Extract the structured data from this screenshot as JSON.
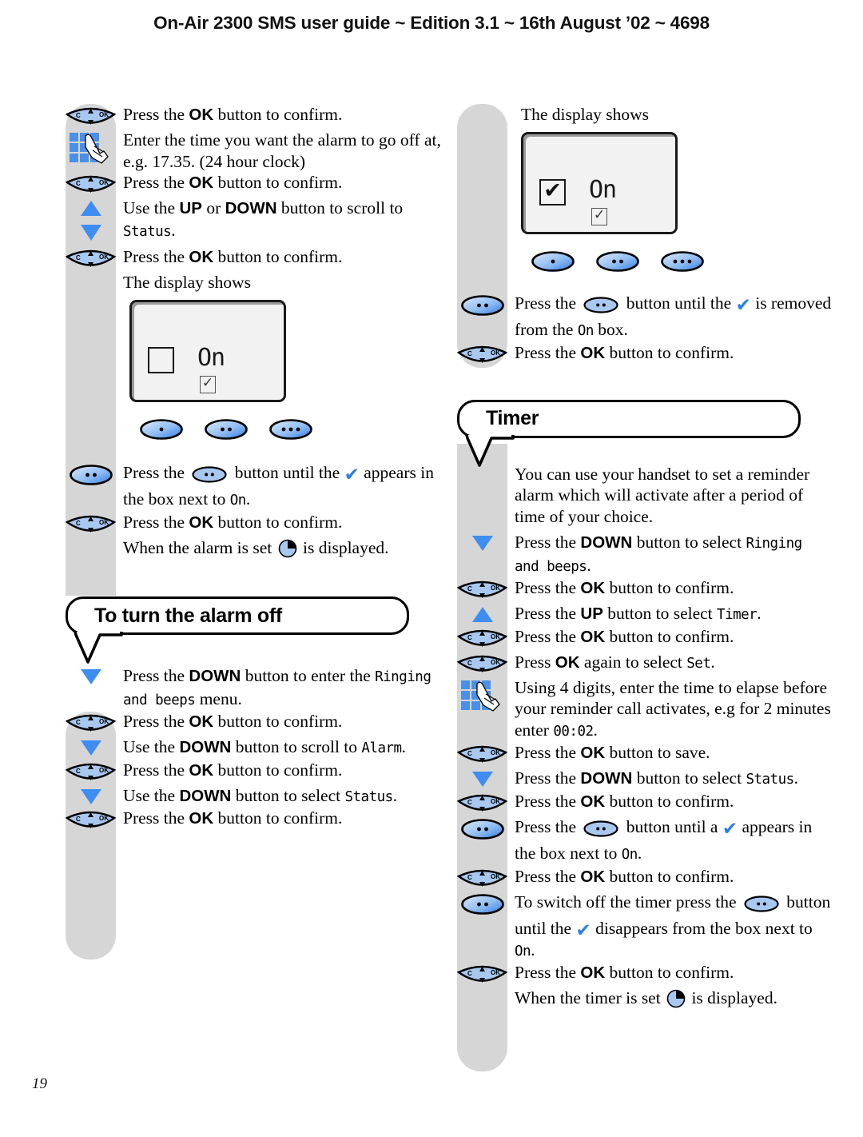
{
  "header": {
    "title": "On-Air 2300 SMS user guide ~ Edition 3.1 ~ 16th August ’02 ~ 4698"
  },
  "page_number": "19",
  "icons": {
    "navkey": {
      "left_label": "C",
      "right_label": "OK",
      "name": "ok-navigation-key-icon"
    },
    "keypad": {
      "name": "keypad-hand-icon"
    },
    "up": {
      "name": "up-arrow-icon"
    },
    "down": {
      "name": "down-arrow-icon"
    },
    "softkey_1dot": {
      "name": "softkey-one-dot-icon"
    },
    "softkey_2dot": {
      "name": "softkey-two-dot-icon"
    },
    "softkey_3dot": {
      "name": "softkey-three-dot-icon"
    },
    "check": {
      "name": "blue-check-icon",
      "glyph": "✔"
    },
    "clock": {
      "name": "clock-icon"
    }
  },
  "colors": {
    "rail_grey": "#d6d6d6",
    "key_blue": "#a8c8f0",
    "keypad_blue": "#4a90e8",
    "check_blue": "#2b7fe8",
    "lcd_bg": "#f2f2f2",
    "outline": "#000000"
  },
  "left_column": {
    "steps_top": [
      {
        "icon": "navkey",
        "parts": [
          {
            "t": "Press the "
          },
          {
            "t": "OK",
            "b": true
          },
          {
            "t": " button to confirm."
          }
        ]
      },
      {
        "icon": "keypad",
        "parts": [
          {
            "t": "Enter the time you want the alarm to go off at, e.g. 17.35. (24 hour clock)"
          }
        ]
      },
      {
        "icon": "navkey",
        "parts": [
          {
            "t": "Press the "
          },
          {
            "t": "OK",
            "b": true
          },
          {
            "t": " button to confirm."
          }
        ]
      },
      {
        "icon": "updown",
        "parts": [
          {
            "t": "Use the "
          },
          {
            "t": "UP",
            "b": true
          },
          {
            "t": " or "
          },
          {
            "t": "DOWN",
            "b": true
          },
          {
            "t": " button to scroll to "
          },
          {
            "t": "Status",
            "lcd": true
          },
          {
            "t": "."
          }
        ]
      },
      {
        "icon": "navkey",
        "parts": [
          {
            "t": "Press the "
          },
          {
            "t": "OK",
            "b": true
          },
          {
            "t": " button to confirm."
          }
        ]
      },
      {
        "icon": "none",
        "parts": [
          {
            "t": "The display shows"
          }
        ]
      }
    ],
    "display_label": "The display shows",
    "lcd": {
      "main_box_mark": "",
      "on_text": "On",
      "small_box_mark": "✓"
    },
    "steps_bottom": [
      {
        "icon": "softkey2",
        "parts": [
          {
            "t": "Press the "
          },
          {
            "oval": 2
          },
          {
            "t": " button until the "
          },
          {
            "check": true
          },
          {
            "t": " appears in the box next to "
          },
          {
            "t": "On",
            "lcd": true
          },
          {
            "t": "."
          }
        ]
      },
      {
        "icon": "navkey",
        "parts": [
          {
            "t": "Press the "
          },
          {
            "t": "OK",
            "b": true
          },
          {
            "t": " button to confirm."
          }
        ]
      },
      {
        "icon": "none",
        "parts": [
          {
            "t": "When the alarm is set "
          },
          {
            "clock": true
          },
          {
            "t": " is displayed."
          }
        ]
      }
    ],
    "heading": "To turn the alarm off",
    "steps_alarm_off": [
      {
        "icon": "down",
        "parts": [
          {
            "t": "Press the "
          },
          {
            "t": "DOWN",
            "b": true
          },
          {
            "t": " button to enter the "
          },
          {
            "t": "Ringing and beeps",
            "lcd": true
          },
          {
            "t": " menu."
          }
        ]
      },
      {
        "icon": "navkey",
        "parts": [
          {
            "t": "Press the "
          },
          {
            "t": "OK",
            "b": true
          },
          {
            "t": " button to confirm."
          }
        ]
      },
      {
        "icon": "down",
        "parts": [
          {
            "t": "Use the "
          },
          {
            "t": "DOWN",
            "b": true
          },
          {
            "t": " button to scroll to "
          },
          {
            "t": "Alarm",
            "lcd": true
          },
          {
            "t": "."
          }
        ]
      },
      {
        "icon": "navkey",
        "parts": [
          {
            "t": "Press the "
          },
          {
            "t": "OK",
            "b": true
          },
          {
            "t": " button to confirm."
          }
        ]
      },
      {
        "icon": "down",
        "parts": [
          {
            "t": "Use the "
          },
          {
            "t": "DOWN",
            "b": true
          },
          {
            "t": " button to select "
          },
          {
            "t": "Status",
            "lcd": true
          },
          {
            "t": "."
          }
        ]
      },
      {
        "icon": "navkey",
        "parts": [
          {
            "t": "Press the "
          },
          {
            "t": "OK",
            "b": true
          },
          {
            "t": " button to confirm."
          }
        ]
      }
    ]
  },
  "right_column": {
    "display_label": "The display shows",
    "lcd": {
      "main_box_mark": "✔",
      "on_text": "On",
      "small_box_mark": "✓"
    },
    "steps_top": [
      {
        "icon": "softkey2",
        "parts": [
          {
            "t": "Press the "
          },
          {
            "oval": 2
          },
          {
            "t": " button until the "
          },
          {
            "check": true
          },
          {
            "t": " is removed from the "
          },
          {
            "t": "On",
            "lcd": true
          },
          {
            "t": " box."
          }
        ]
      },
      {
        "icon": "navkey",
        "parts": [
          {
            "t": "Press the "
          },
          {
            "t": "OK",
            "b": true
          },
          {
            "t": " button to confirm."
          }
        ]
      }
    ],
    "heading": "Timer",
    "intro": "You can use your handset to set a reminder alarm which will activate after a period of time of your choice.",
    "steps_timer": [
      {
        "icon": "down",
        "parts": [
          {
            "t": "Press the "
          },
          {
            "t": "DOWN",
            "b": true
          },
          {
            "t": " button to select "
          },
          {
            "t": "Ringing and beeps",
            "lcd": true
          },
          {
            "t": "."
          }
        ]
      },
      {
        "icon": "navkey",
        "parts": [
          {
            "t": "Press the "
          },
          {
            "t": "OK",
            "b": true
          },
          {
            "t": " button to confirm."
          }
        ]
      },
      {
        "icon": "up",
        "parts": [
          {
            "t": "Press the "
          },
          {
            "t": "UP",
            "b": true
          },
          {
            "t": " button to select "
          },
          {
            "t": "Timer",
            "lcd": true
          },
          {
            "t": "."
          }
        ]
      },
      {
        "icon": "navkey",
        "parts": [
          {
            "t": "Press the "
          },
          {
            "t": "OK",
            "b": true
          },
          {
            "t": " button to confirm."
          }
        ]
      },
      {
        "icon": "navkey",
        "parts": [
          {
            "t": "Press "
          },
          {
            "t": "OK",
            "b": true
          },
          {
            "t": " again to select "
          },
          {
            "t": "Set",
            "lcd": true
          },
          {
            "t": "."
          }
        ]
      },
      {
        "icon": "keypad",
        "parts": [
          {
            "t": "Using 4 digits, enter the time to elapse before your reminder call activates, e.g for 2 minutes enter "
          },
          {
            "t": "00:02",
            "lcd": true
          },
          {
            "t": "."
          }
        ]
      },
      {
        "icon": "navkey",
        "parts": [
          {
            "t": "Press the "
          },
          {
            "t": "OK",
            "b": true
          },
          {
            "t": " button to save."
          }
        ]
      },
      {
        "icon": "down",
        "parts": [
          {
            "t": "Press the "
          },
          {
            "t": "DOWN",
            "b": true
          },
          {
            "t": " button to select "
          },
          {
            "t": "Status",
            "lcd": true
          },
          {
            "t": "."
          }
        ]
      },
      {
        "icon": "navkey",
        "parts": [
          {
            "t": "Press the "
          },
          {
            "t": "OK",
            "b": true
          },
          {
            "t": " button to confirm."
          }
        ]
      },
      {
        "icon": "softkey2",
        "parts": [
          {
            "t": "Press the "
          },
          {
            "oval": 2
          },
          {
            "t": " button until a "
          },
          {
            "check": true
          },
          {
            "t": " appears in the box next to "
          },
          {
            "t": "On",
            "lcd": true
          },
          {
            "t": "."
          }
        ]
      },
      {
        "icon": "navkey",
        "parts": [
          {
            "t": "Press the "
          },
          {
            "t": "OK",
            "b": true
          },
          {
            "t": " button to confirm."
          }
        ]
      },
      {
        "icon": "softkey2",
        "parts": [
          {
            "t": "To switch off the timer press the "
          },
          {
            "oval": 2
          },
          {
            "t": " button until the "
          },
          {
            "check": true
          },
          {
            "t": " disappears from the box next to "
          },
          {
            "t": "On",
            "lcd": true
          },
          {
            "t": "."
          }
        ]
      },
      {
        "icon": "navkey",
        "parts": [
          {
            "t": "Press the "
          },
          {
            "t": "OK",
            "b": true
          },
          {
            "t": " button to confirm."
          }
        ]
      },
      {
        "icon": "none",
        "parts": [
          {
            "t": "When the timer is set "
          },
          {
            "clock": true
          },
          {
            "t": " is displayed."
          }
        ]
      }
    ]
  }
}
